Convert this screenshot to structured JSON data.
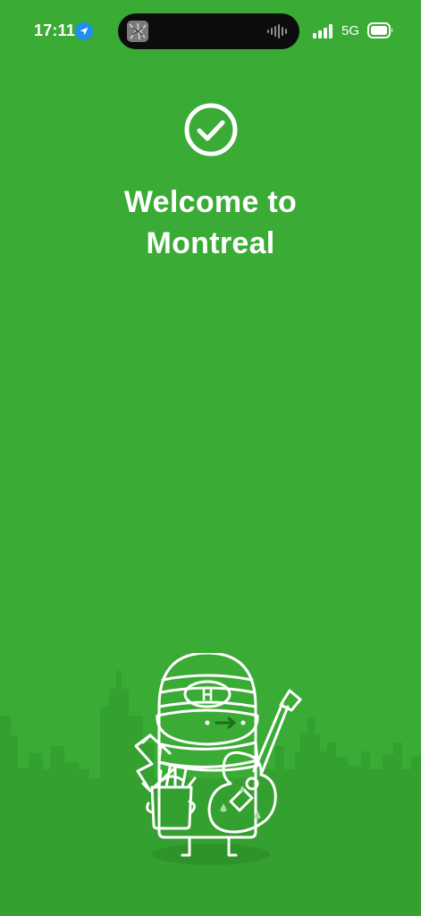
{
  "status_bar": {
    "time": "17:11",
    "network": "5G",
    "location_icon": "location-arrow-icon",
    "signal_icon": "cellular-signal-icon",
    "battery_icon": "battery-icon"
  },
  "dynamic_island": {
    "thumbnail_icon": "album-art-icon",
    "activity_icon": "audio-waveform-icon"
  },
  "main": {
    "check_icon": "checkmark-circle-icon",
    "title_line1": "Welcome to",
    "title_line2": "Montreal"
  },
  "illustration": {
    "name": "montreal-mascot-illustration",
    "hat_logo_letter": "H"
  },
  "colors": {
    "background": "#3aab34",
    "skyline": "#34a02f",
    "foreground": "#ffffff"
  }
}
